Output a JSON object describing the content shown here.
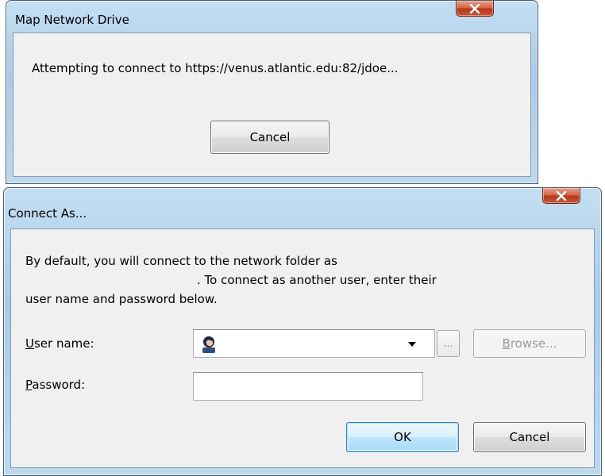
{
  "map_dialog": {
    "title": "Map Network Drive",
    "message": "Attempting to connect to https://venus.atlantic.edu:82/jdoe...",
    "cancel_label": "Cancel"
  },
  "connect_dialog": {
    "title": "Connect As...",
    "message_line1": "By default, you will connect to the network folder as",
    "message_line2": ". To connect as another user, enter their",
    "message_line3": "user name and password below.",
    "username_label_first": "U",
    "username_label_rest": "ser name:",
    "username_value": "",
    "password_label_first": "P",
    "password_label_rest": "assword:",
    "password_value": "",
    "ellipsis_label": "...",
    "browse_label_first": "B",
    "browse_label_rest": "rowse...",
    "ok_label": "OK",
    "cancel_label": "Cancel"
  },
  "icons": {
    "close": "close-icon",
    "user": "user-avatar-icon",
    "dropdown": "chevron-down-icon"
  }
}
